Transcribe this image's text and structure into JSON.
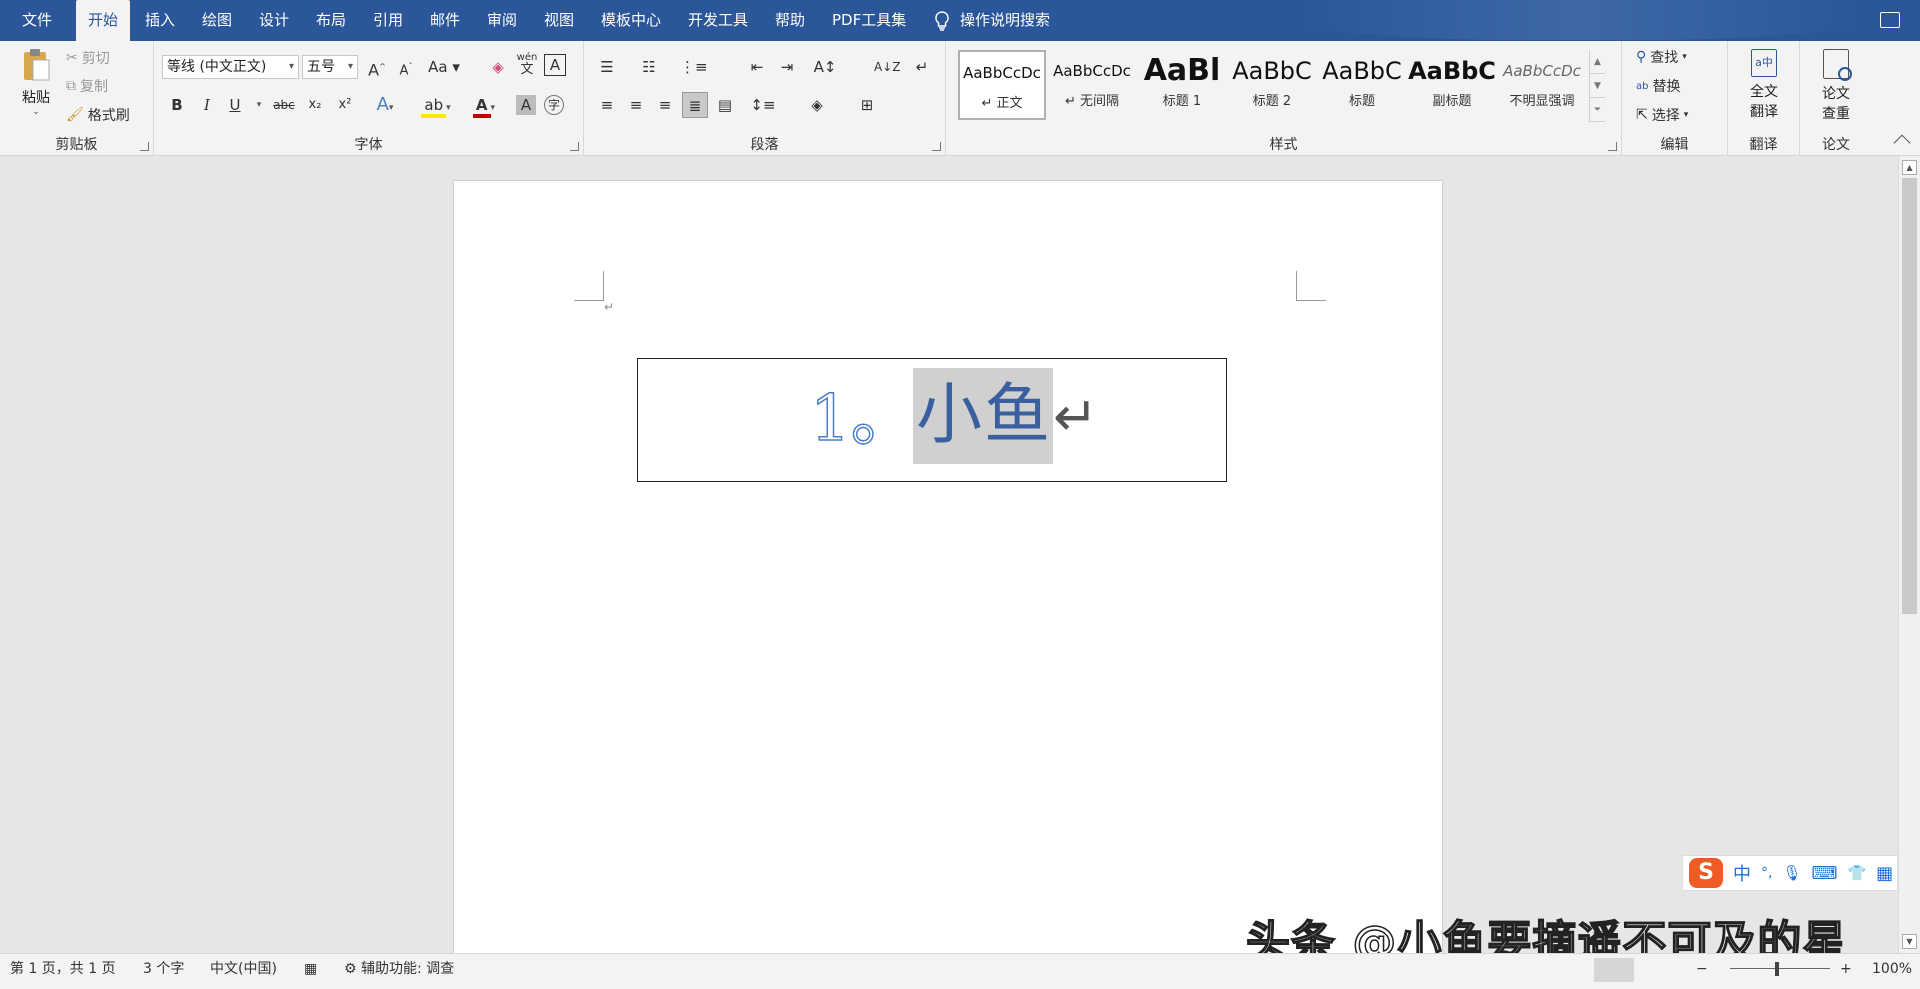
{
  "tabs": [
    "文件",
    "开始",
    "插入",
    "绘图",
    "设计",
    "布局",
    "引用",
    "邮件",
    "审阅",
    "视图",
    "模板中心",
    "开发工具",
    "帮助",
    "PDF工具集"
  ],
  "active_tab": "开始",
  "tell_me": "操作说明搜索",
  "clipboard": {
    "paste": "粘贴",
    "cut": "剪切",
    "copy": "复制",
    "format_painter": "格式刷",
    "label": "剪贴板"
  },
  "font": {
    "name": "等线 (中文正文)",
    "size": "五号",
    "label": "字体",
    "bold": "B",
    "italic": "I",
    "underline": "U",
    "strike": "abc",
    "sub": "x₂",
    "sup": "x²",
    "grow": "A",
    "shrink": "A",
    "case": "Aa",
    "phonetic_top": "wén",
    "phonetic_bottom": "文",
    "border_char": "A",
    "color_char": "A",
    "shade_char": "A",
    "enclose": "字"
  },
  "paragraph": {
    "label": "段落"
  },
  "styles": {
    "label": "样式",
    "items": [
      {
        "preview": "AaBbCcDc",
        "name": "↵ 正文"
      },
      {
        "preview": "AaBbCcDc",
        "name": "↵ 无间隔"
      },
      {
        "preview": "AaBl",
        "name": "标题 1"
      },
      {
        "preview": "AaBbC",
        "name": "标题 2"
      },
      {
        "preview": "AaBbC",
        "name": "标题"
      },
      {
        "preview": "AaBbC",
        "name": "副标题"
      },
      {
        "preview": "AaBbCcDc",
        "name": "不明显强调"
      }
    ]
  },
  "editing": {
    "find": "查找",
    "replace": "替换",
    "select": "选择",
    "label": "编辑"
  },
  "translate": {
    "line1": "全文",
    "line2": "翻译",
    "label": "翻译"
  },
  "paper": {
    "line1": "论文",
    "line2": "查重",
    "label": "论文"
  },
  "document": {
    "number": "1。",
    "heading": "小鱼",
    "return_mark": "↵",
    "small_mark": "↵"
  },
  "ime": {
    "logo": "S",
    "mode": "中",
    "punct": "°,",
    "mic": "🎙",
    "kb": "⌨",
    "skin": "👕",
    "grid": "▦"
  },
  "watermark": "头条 @小鱼要摘遥不可及的星",
  "status": {
    "page": "第 1 页，共 1 页",
    "words": "3 个字",
    "language": "中文(中国)",
    "accessibility": "辅助功能: 调查",
    "zoom": "100%",
    "minus": "−",
    "plus": "+"
  }
}
